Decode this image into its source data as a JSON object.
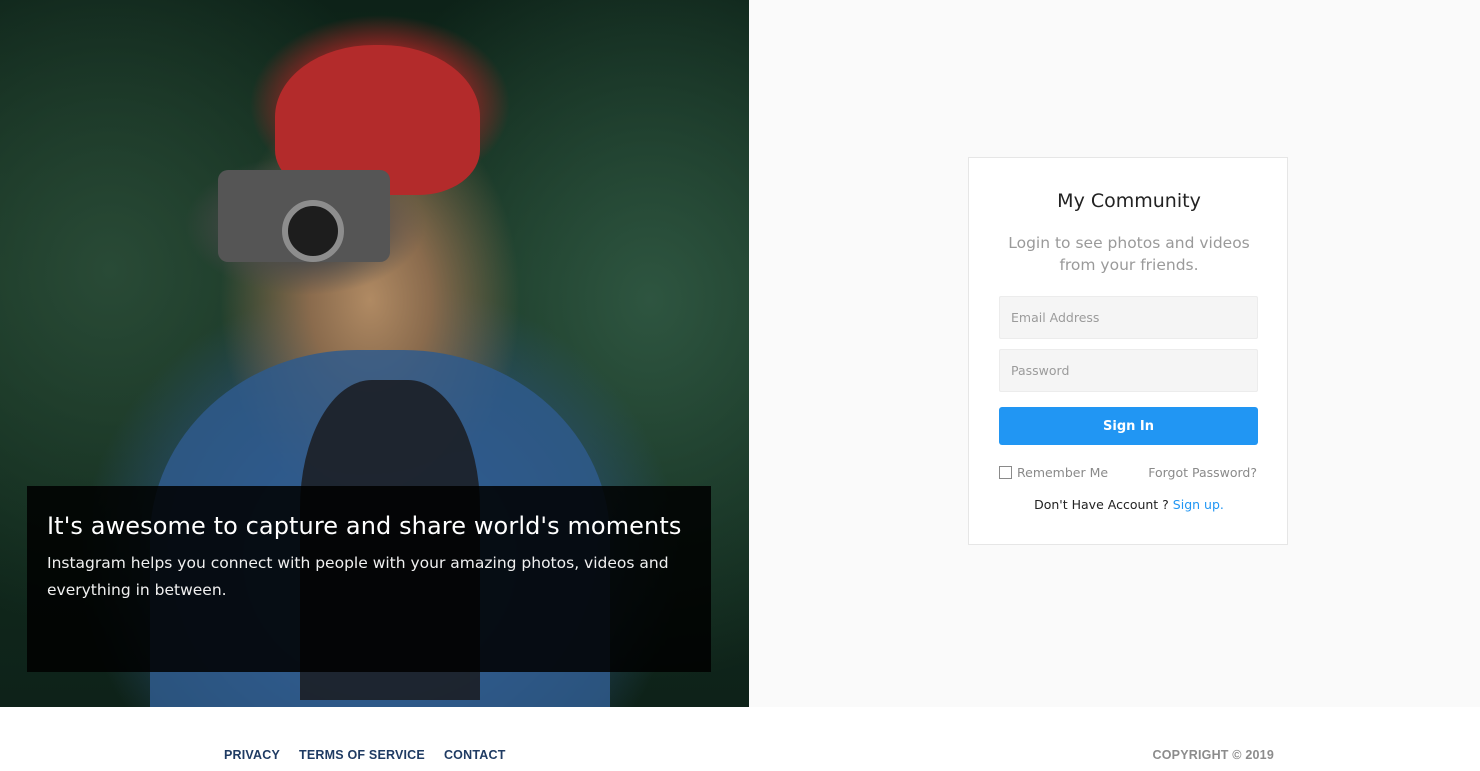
{
  "hero": {
    "image_alt": "Woman in red beanie holding a vintage camera among pine trees",
    "title": "It's awesome to capture and share world's moments",
    "text": "Instagram helps you connect with people with your amazing photos, videos and everything in between."
  },
  "login": {
    "title": "My Community",
    "subtitle": "Login to see photos and videos from your friends.",
    "email_placeholder": "Email Address",
    "password_placeholder": "Password",
    "signin_label": "Sign In",
    "remember_label": "Remember Me",
    "forgot_label": "Forgot Password?",
    "no_account_text": "Don't Have Account ? ",
    "signup_label": "Sign up."
  },
  "footer": {
    "links": [
      "PRIVACY",
      "TERMS OF SERVICE",
      "CONTACT"
    ],
    "copyright": "COPYRIGHT © 2019"
  },
  "colors": {
    "accent": "#2196f3",
    "footer_link": "#1f3b63",
    "background": "#fafafa"
  }
}
